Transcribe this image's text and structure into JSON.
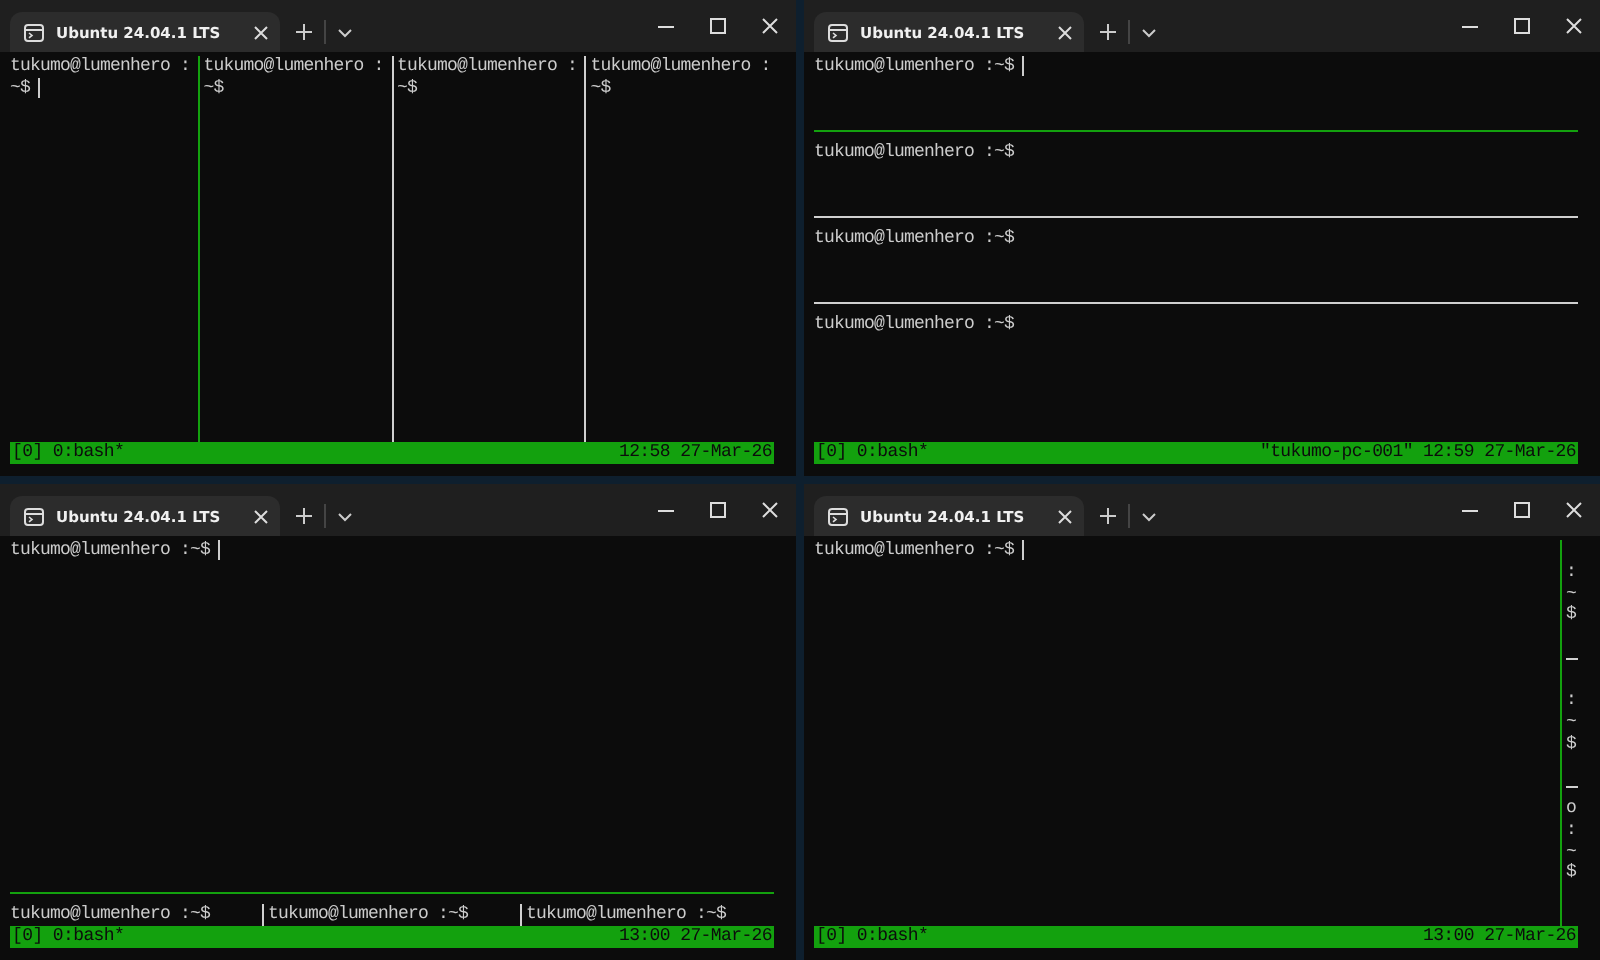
{
  "windows": [
    {
      "tab_title": "Ubuntu 24.04.1 LTS",
      "kind": "columns",
      "panes": [
        {
          "lines": [
            "tukumo@lumenhero :",
            "~$"
          ],
          "active": true
        },
        {
          "lines": [
            "tukumo@lumenhero :",
            "~$"
          ],
          "active": false
        },
        {
          "lines": [
            "tukumo@lumenhero :",
            "~$"
          ],
          "active": false
        },
        {
          "lines": [
            "tukumo@lumenhero :",
            "~$"
          ],
          "active": false
        }
      ],
      "status": {
        "session": "[0] 0:bash*",
        "clock": "12:58 27-Mar-26"
      }
    },
    {
      "tab_title": "Ubuntu 24.04.1 LTS",
      "kind": "rows",
      "panes": [
        {
          "lines": [
            "tukumo@lumenhero :~$"
          ],
          "active": true
        },
        {
          "lines": [
            "tukumo@lumenhero :~$"
          ],
          "active": false
        },
        {
          "lines": [
            "tukumo@lumenhero :~$"
          ],
          "active": false
        },
        {
          "lines": [
            "tukumo@lumenhero :~$"
          ],
          "active": false
        }
      ],
      "status": {
        "session": "[0] 0:bash*",
        "host": "\"tukumo-pc-001\"",
        "clock": "12:59 27-Mar-26"
      }
    },
    {
      "tab_title": "Ubuntu 24.04.1 LTS",
      "kind": "main-bottom",
      "panes": [
        {
          "lines": [
            "tukumo@lumenhero :~$"
          ],
          "active": true
        },
        {
          "lines": [
            "tukumo@lumenhero :~$"
          ],
          "active": false
        },
        {
          "lines": [
            "tukumo@lumenhero :~$"
          ],
          "active": false
        },
        {
          "lines": [
            "tukumo@lumenhero :~$"
          ],
          "active": false
        }
      ],
      "status": {
        "session": "[0] 0:bash*",
        "clock": "13:00 27-Mar-26"
      }
    },
    {
      "tab_title": "Ubuntu 24.04.1 LTS",
      "kind": "main-right",
      "panes": [
        {
          "lines": [
            "tukumo@lumenhero :~$"
          ],
          "active": true
        },
        {
          "lines": [
            " :~$"
          ],
          "active": false
        },
        {
          "lines": [
            " :~$"
          ],
          "active": false
        },
        {
          "lines": [
            "o :~$"
          ],
          "active": false
        }
      ],
      "status": {
        "session": "[0] 0:bash*",
        "clock": "13:00 27-Mar-26"
      }
    }
  ]
}
